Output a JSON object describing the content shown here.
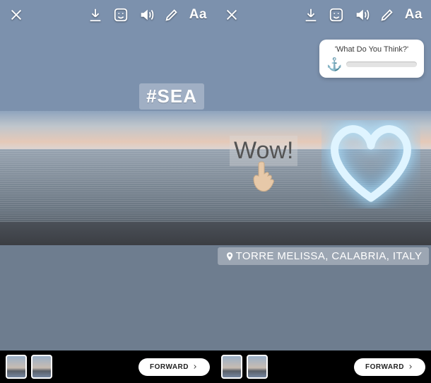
{
  "left_panel": {
    "toolbar": {
      "close": "close",
      "download": "download",
      "sticker": "sticker",
      "sound": "sound",
      "draw": "draw",
      "text_tool": "Aa"
    },
    "hashtag": "#SEA",
    "thumbnails": [
      "thumb-1",
      "thumb-2"
    ],
    "forward_label": "FORWARD"
  },
  "right_panel": {
    "toolbar": {
      "close": "close",
      "download": "download",
      "sticker": "sticker",
      "sound": "sound",
      "draw": "draw",
      "text_tool": "Aa"
    },
    "poll": {
      "title": "'What Do You Think?'",
      "emoji": "⚓"
    },
    "wow_text": "Wow!",
    "location": {
      "text": "TORRE MELISSA, CALABRIA, ITALY"
    },
    "thumbnails": [
      "thumb-1",
      "thumb-2"
    ],
    "forward_label": "FORWARD"
  }
}
